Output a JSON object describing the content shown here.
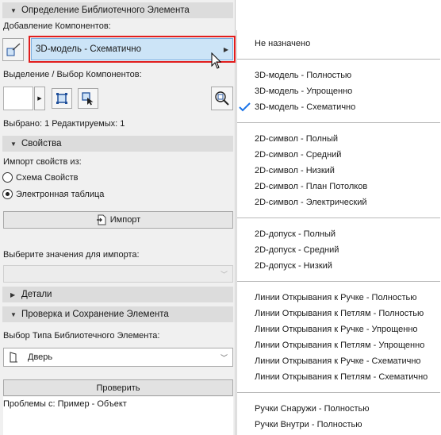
{
  "panel": {
    "sec_library": "Определение Библиотечного Элемента",
    "add_components_label": "Добавление Компонентов:",
    "dropdown_value": "3D-модель - Схематично",
    "selection_label": "Выделение / Выбор Компонентов:",
    "selected_text": "Выбрано: 1 Редактируемых: 1",
    "sec_properties": "Свойства",
    "import_from_label": "Импорт свойств из:",
    "radio_scheme": "Схема Свойств",
    "radio_sheet": "Электронная таблица",
    "import_button": "Импорт",
    "choose_values_label": "Выберите значения для импорта:",
    "sec_details": "Детали",
    "sec_check": "Проверка и Сохранение Элемента",
    "type_label": "Выбор Типа Библиотечного Элемента:",
    "type_value": "Дверь",
    "check_button": "Проверить",
    "problems_text": "Проблемы с: Пример - Объект"
  },
  "menu": {
    "items": [
      "Не назначено",
      "3D-модель - Полностью",
      "3D-модель - Упрощенно",
      "3D-модель - Схематично",
      "2D-символ - Полный",
      "2D-символ - Средний",
      "2D-символ - Низкий",
      "2D-символ - План Потолков",
      "2D-символ - Электрический",
      "2D-допуск - Полный",
      "2D-допуск - Средний",
      "2D-допуск - Низкий",
      "Линии Открывания к Ручке - Полностью",
      "Линии Открывания к Петлям - Полностью",
      "Линии Открывания к Ручке - Упрощенно",
      "Линии Открывания к Петлям - Упрощенно",
      "Линии Открывания к Ручке - Схематично",
      "Линии Открывания к Петлям - Схематично",
      "Ручки Снаружи - Полностью",
      "Ручки Внутри - Полностью"
    ],
    "checked_item": "3D-модель - Схематично"
  },
  "colors": {
    "highlight": "#cce4f7",
    "highlight_border": "#e11d1d",
    "accent": "#1a73e8"
  }
}
